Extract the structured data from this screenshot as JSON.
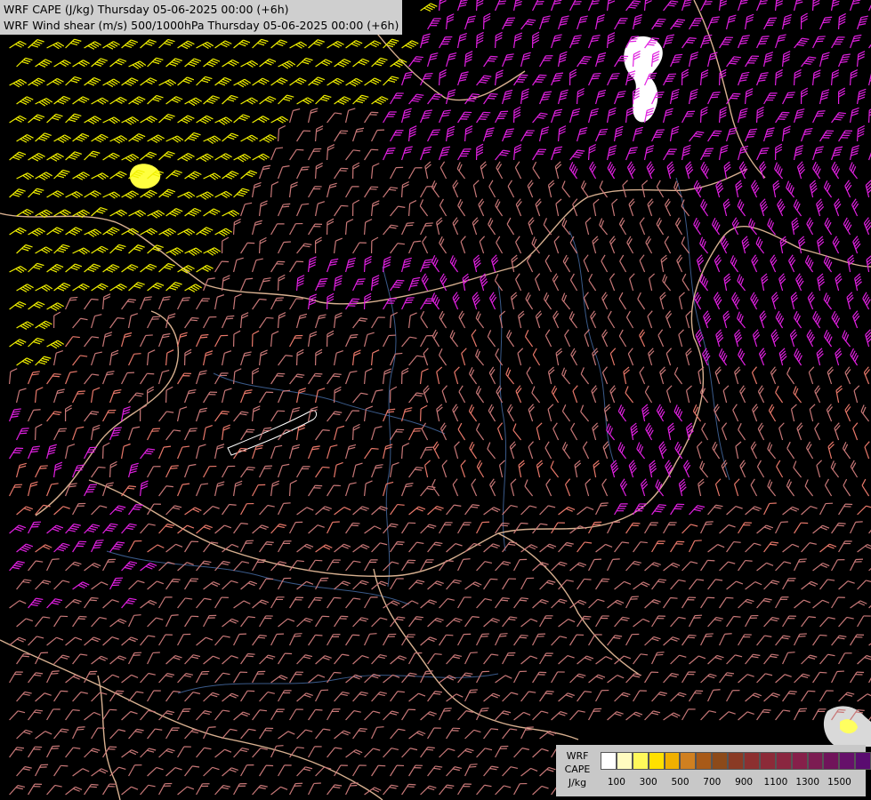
{
  "header": {
    "line1": "WRF CAPE (J/kg) Thursday 05-06-2025 00:00 (+6h)",
    "line2": "WRF Wind shear (m/s) 500/1000hPa Thursday 05-06-2025 00:00 (+6h)"
  },
  "legend": {
    "label_line1": "WRF",
    "label_line2": "CAPE",
    "label_line3": "J/kg",
    "swatch_colors": [
      "#ffffff",
      "#fffcc0",
      "#fff85a",
      "#ffe000",
      "#f0b000",
      "#d08020",
      "#a85a18",
      "#8c4a1a",
      "#8a3a24",
      "#8c3030",
      "#8c2a38",
      "#8a2640",
      "#86204a",
      "#7c1c52",
      "#70145a",
      "#66106a",
      "#5a0c70",
      "#4a0870"
    ],
    "tick_labels": [
      "100",
      "300",
      "500",
      "700",
      "900",
      "1100",
      "1300",
      "1500"
    ]
  },
  "colors": {
    "background": "#000000",
    "barb_low": "#c87878",
    "barb_mid": "#e8786a",
    "barb_magenta": "#e020e0",
    "barb_yellow": "#f0f000",
    "border": "#d8b090",
    "river": "#3a5a8a",
    "cape_white": "#ffffff",
    "cape_yellow": "#ffff00",
    "contour_gray": "#888888"
  },
  "icons": [
    "wind-barb-icon"
  ]
}
